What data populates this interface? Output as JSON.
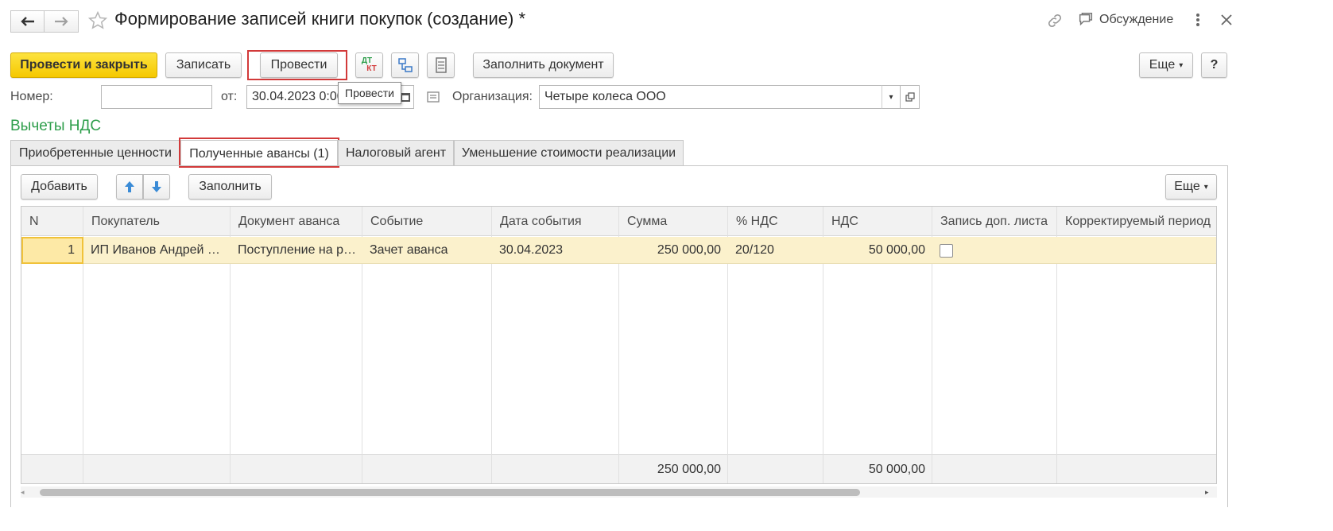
{
  "window": {
    "title": "Формирование записей книги покупок (создание) *",
    "discussion_label": "Обсуждение"
  },
  "toolbar": {
    "post_close_label": "Провести и закрыть",
    "save_label": "Записать",
    "post_label": "Провести",
    "dt_label": "ДТ",
    "kt_label": "КТ",
    "fill_doc_label": "Заполнить документ",
    "more_label": "Еще",
    "help_label": "?",
    "tooltip": "Провести"
  },
  "header_fields": {
    "number_label": "Номер:",
    "number_value": "",
    "date_label": "от:",
    "date_value": "30.04.2023  0:00",
    "org_label": "Организация:",
    "org_value": "Четыре колеса ООО"
  },
  "section_title": "Вычеты НДС",
  "tabs": [
    {
      "label": "Приобретенные ценности"
    },
    {
      "label": "Полученные авансы (1)"
    },
    {
      "label": "Налоговый агент"
    },
    {
      "label": "Уменьшение стоимости реализации"
    }
  ],
  "tab_toolbar": {
    "add_label": "Добавить",
    "fill_label": "Заполнить",
    "more_label": "Еще"
  },
  "table": {
    "columns": [
      "N",
      "Покупатель",
      "Документ аванса",
      "Событие",
      "Дата события",
      "Сумма",
      "% НДС",
      "НДС",
      "Запись доп. листа",
      "Корректируемый период"
    ],
    "rows": [
      {
        "n": "1",
        "buyer": "ИП Иванов Андрей …",
        "doc": "Поступление на р…",
        "event": "Зачет аванса",
        "date": "30.04.2023",
        "sum": "250 000,00",
        "vat_rate": "20/120",
        "vat": "50 000,00",
        "extra_sheet": false,
        "period": ""
      }
    ],
    "totals": {
      "sum": "250 000,00",
      "vat": "50 000,00"
    }
  },
  "colors": {
    "section_title": "#2e9e4b",
    "highlight_border": "#d23a3a",
    "primary_button": "#f5c800",
    "selected_row": "#fbf1cc"
  }
}
